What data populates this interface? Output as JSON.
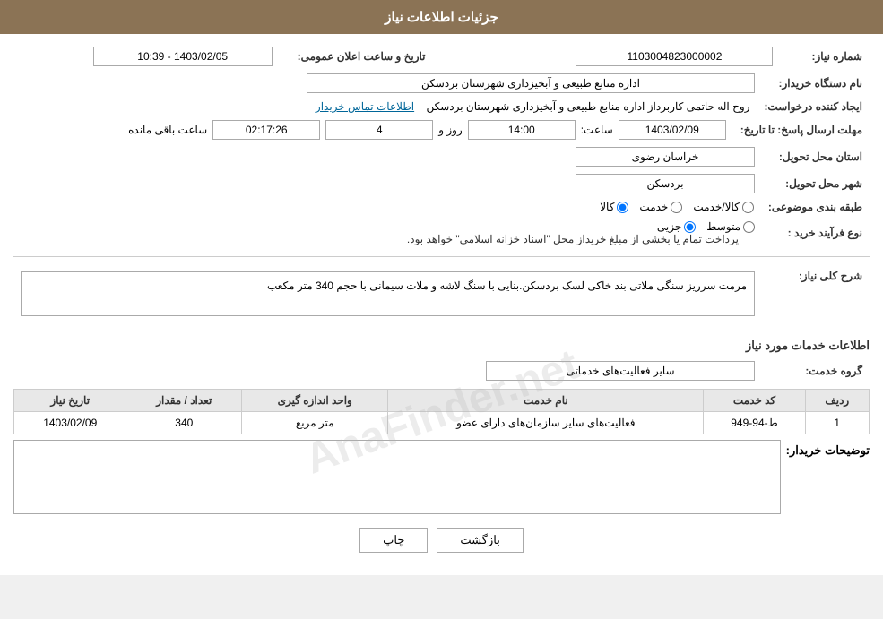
{
  "header": {
    "title": "جزئیات اطلاعات نیاز"
  },
  "fields": {
    "request_number_label": "شماره نیاز:",
    "request_number_value": "1103004823000002",
    "buyer_org_label": "نام دستگاه خریدار:",
    "buyer_org_value": "اداره منابع طبیعی و آبخیزداری شهرستان بردسکن",
    "creator_label": "ایجاد کننده درخواست:",
    "creator_value": "روح اله حاتمی کاربرداز اداره منابع طبیعی و آبخیزداری شهرستان بردسکن",
    "creator_link": "اطلاعات تماس خریدار",
    "response_deadline_label": "مهلت ارسال پاسخ: تا تاریخ:",
    "response_date": "1403/02/09",
    "response_time_label": "ساعت:",
    "response_time": "14:00",
    "response_days_label": "روز و",
    "response_days": "4",
    "response_remaining_label": "ساعت باقی مانده",
    "response_remaining": "02:17:26",
    "delivery_province_label": "استان محل تحویل:",
    "delivery_province": "خراسان رضوی",
    "delivery_city_label": "شهر محل تحویل:",
    "delivery_city": "بردسکن",
    "category_label": "طبقه بندی موضوعی:",
    "category_kala": "کالا",
    "category_khedmat": "خدمت",
    "category_kala_khedmat": "کالا/خدمت",
    "purchase_type_label": "نوع فرآیند خرید :",
    "purchase_type_jazzi": "جزیی",
    "purchase_type_motavasset": "متوسط",
    "purchase_note": "پرداخت تمام یا بخشی از مبلغ خریداز محل \"اسناد خزانه اسلامی\" خواهد بود.",
    "description_title": "شرح کلی نیاز:",
    "description_value": "مرمت سرریز سنگی ملاتی بند خاکی لسک بردسکن.بنایی با سنگ لاشه و ملات سیمانی با حجم 340 متر مکعب",
    "services_title": "اطلاعات خدمات مورد نیاز",
    "service_group_label": "گروه خدمت:",
    "service_group_value": "سایر فعالیت‌های خدماتی",
    "table": {
      "columns": [
        "ردیف",
        "کد خدمت",
        "نام خدمت",
        "واحد اندازه گیری",
        "تعداد / مقدار",
        "تاریخ نیاز"
      ],
      "rows": [
        {
          "row": "1",
          "code": "ط-94-949",
          "name": "فعالیت‌های سایر سازمان‌های دارای عضو",
          "unit": "متر مربع",
          "quantity": "340",
          "date": "1403/02/09"
        }
      ]
    },
    "buyer_notes_label": "توضیحات خریدار:",
    "buyer_notes_value": ""
  },
  "buttons": {
    "print_label": "چاپ",
    "back_label": "بازگشت"
  },
  "date_label": "تاریخ و ساعت اعلان عمومی:"
}
